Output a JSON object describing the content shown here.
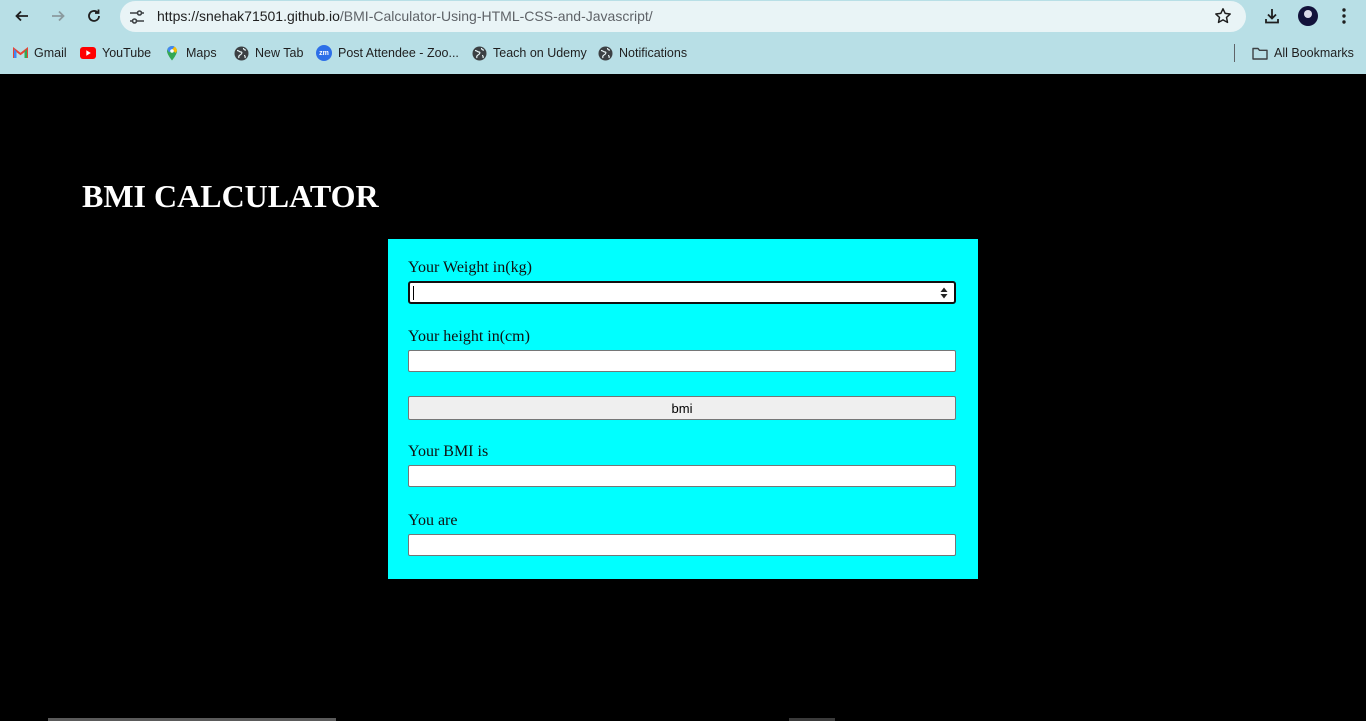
{
  "browser": {
    "url_host": "https://snehak71501.github.io",
    "url_path": "/BMI-Calculator-Using-HTML-CSS-and-Javascript/",
    "bookmarks": [
      {
        "label": "Gmail",
        "icon": "gmail-icon"
      },
      {
        "label": "YouTube",
        "icon": "youtube-icon"
      },
      {
        "label": "Maps",
        "icon": "maps-icon"
      },
      {
        "label": "New Tab",
        "icon": "globe-icon"
      },
      {
        "label": "Post Attendee - Zoo...",
        "icon": "zoom-icon"
      },
      {
        "label": "Teach on Udemy",
        "icon": "globe-icon"
      },
      {
        "label": "Notifications",
        "icon": "globe-icon"
      }
    ],
    "all_bookmarks": "All Bookmarks",
    "zoom_badge": "zm"
  },
  "page": {
    "title": "BMI CALCULATOR",
    "weight_label": "Your Weight in(kg)",
    "weight_value": "",
    "height_label": "Your height in(cm)",
    "height_value": "",
    "bmi_button": "bmi",
    "result_label": "Your BMI is",
    "result_value": "",
    "category_label": "You are",
    "category_value": ""
  },
  "colors": {
    "page_bg": "#000000",
    "card_bg": "#00ffff",
    "chrome_bg": "#b8dfe6"
  }
}
